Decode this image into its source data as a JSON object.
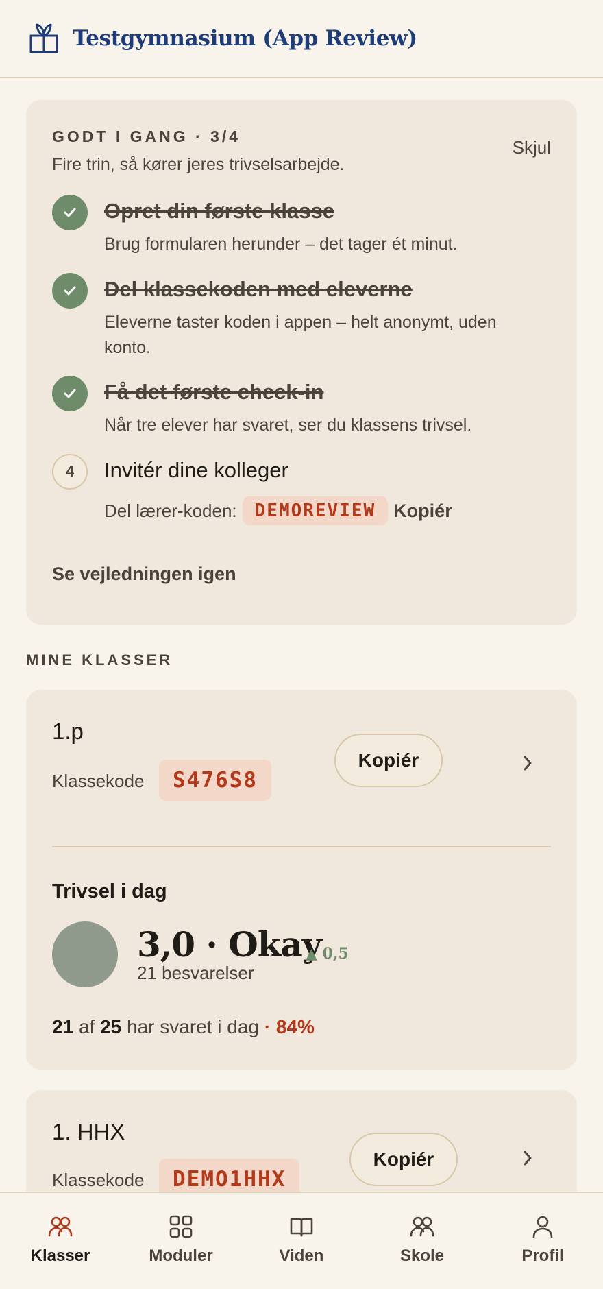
{
  "header": {
    "title": "Testgymnasium (App Review)",
    "logo_icon": "book-sprout-icon"
  },
  "onboarding": {
    "eyebrow": "GODT I GANG · 3/4",
    "subtitle": "Fire trin, så kører jeres trivselsarbejde.",
    "hide_label": "Skjul",
    "steps": [
      {
        "title": "Opret din første klasse",
        "desc": "Brug formularen herunder – det tager ét minut.",
        "done": true
      },
      {
        "title": "Del klassekoden med eleverne",
        "desc": "Eleverne taster koden i appen – helt anonymt, uden konto.",
        "done": true
      },
      {
        "title": "Få det første check-in",
        "desc": "Når tre elever har svaret, ser du klassens trivsel.",
        "done": true
      },
      {
        "number": "4",
        "title": "Invitér dine kolleger",
        "code_label": "Del lærer-koden:",
        "code": "DEMOREVIEW",
        "copy_label": "Kopiér",
        "done": false
      }
    ],
    "guide_link": "Se vejledningen igen"
  },
  "classes_section_label": "MINE KLASSER",
  "classes": [
    {
      "name": "1.p",
      "code_label": "Klassekode",
      "code": "S476S8",
      "copy_label": "Kopiér",
      "wellbeing": {
        "title": "Trivsel i dag",
        "score_text": "3,0 · Okay",
        "delta": "▲ 0,5",
        "responses": "21 besvarelser",
        "answered": "21",
        "of": "af",
        "total": "25",
        "answered_suffix": "har svaret i dag",
        "percent": "· 84%"
      }
    },
    {
      "name": "1. HHX",
      "code_label": "Klassekode",
      "code": "DEMO1HHX",
      "copy_label": "Kopiér"
    }
  ],
  "nav": [
    {
      "label": "Klasser",
      "icon": "people-icon",
      "active": true
    },
    {
      "label": "Moduler",
      "icon": "grid-icon",
      "active": false
    },
    {
      "label": "Viden",
      "icon": "book-icon",
      "active": false
    },
    {
      "label": "Skole",
      "icon": "people-icon",
      "active": false
    },
    {
      "label": "Profil",
      "icon": "person-icon",
      "active": false
    }
  ],
  "colors": {
    "accent": "#b3391b",
    "brand": "#1e3d78",
    "success": "#6f8c6a",
    "card": "#f0e8dc",
    "background": "#f8f4ec"
  }
}
